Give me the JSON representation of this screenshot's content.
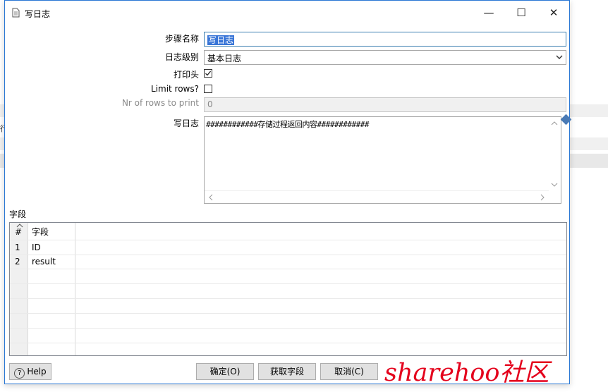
{
  "window": {
    "title": "写日志",
    "controls": {
      "minimize": "—",
      "maximize": "☐",
      "close": "✕"
    }
  },
  "form": {
    "step_name_label": "步骤名称",
    "step_name_value": "写日志",
    "log_level_label": "日志级别",
    "log_level_value": "基本日志",
    "print_header_label": "打印头",
    "print_header_checked": true,
    "limit_rows_label": "Limit rows?",
    "limit_rows_checked": false,
    "nr_rows_label": "Nr of rows to print",
    "nr_rows_value": "0",
    "write_log_label": "写日志",
    "write_log_value": "############存储过程返回内容############"
  },
  "fields": {
    "section_label": "字段",
    "headers": {
      "num": "#",
      "field": "字段"
    },
    "rows": [
      {
        "num": "1",
        "field": "ID"
      },
      {
        "num": "2",
        "field": "result"
      }
    ]
  },
  "buttons": {
    "help": "Help",
    "ok": "确定(O)",
    "get_fields": "获取字段",
    "cancel": "取消(C)"
  },
  "watermark": "sharehoo社区",
  "background": {
    "fragment": "行"
  },
  "icons": [
    "file-icon",
    "minimize-icon",
    "maximize-icon",
    "close-icon",
    "checkmark-icon",
    "dropdown-arrow-icon",
    "variable-icon",
    "help-icon",
    "sort-icon"
  ],
  "colors": {
    "selection": "#3875d7",
    "focus_border": "#3c7fb1",
    "watermark": "#e4001c",
    "dialog_border": "#2b78d4"
  }
}
